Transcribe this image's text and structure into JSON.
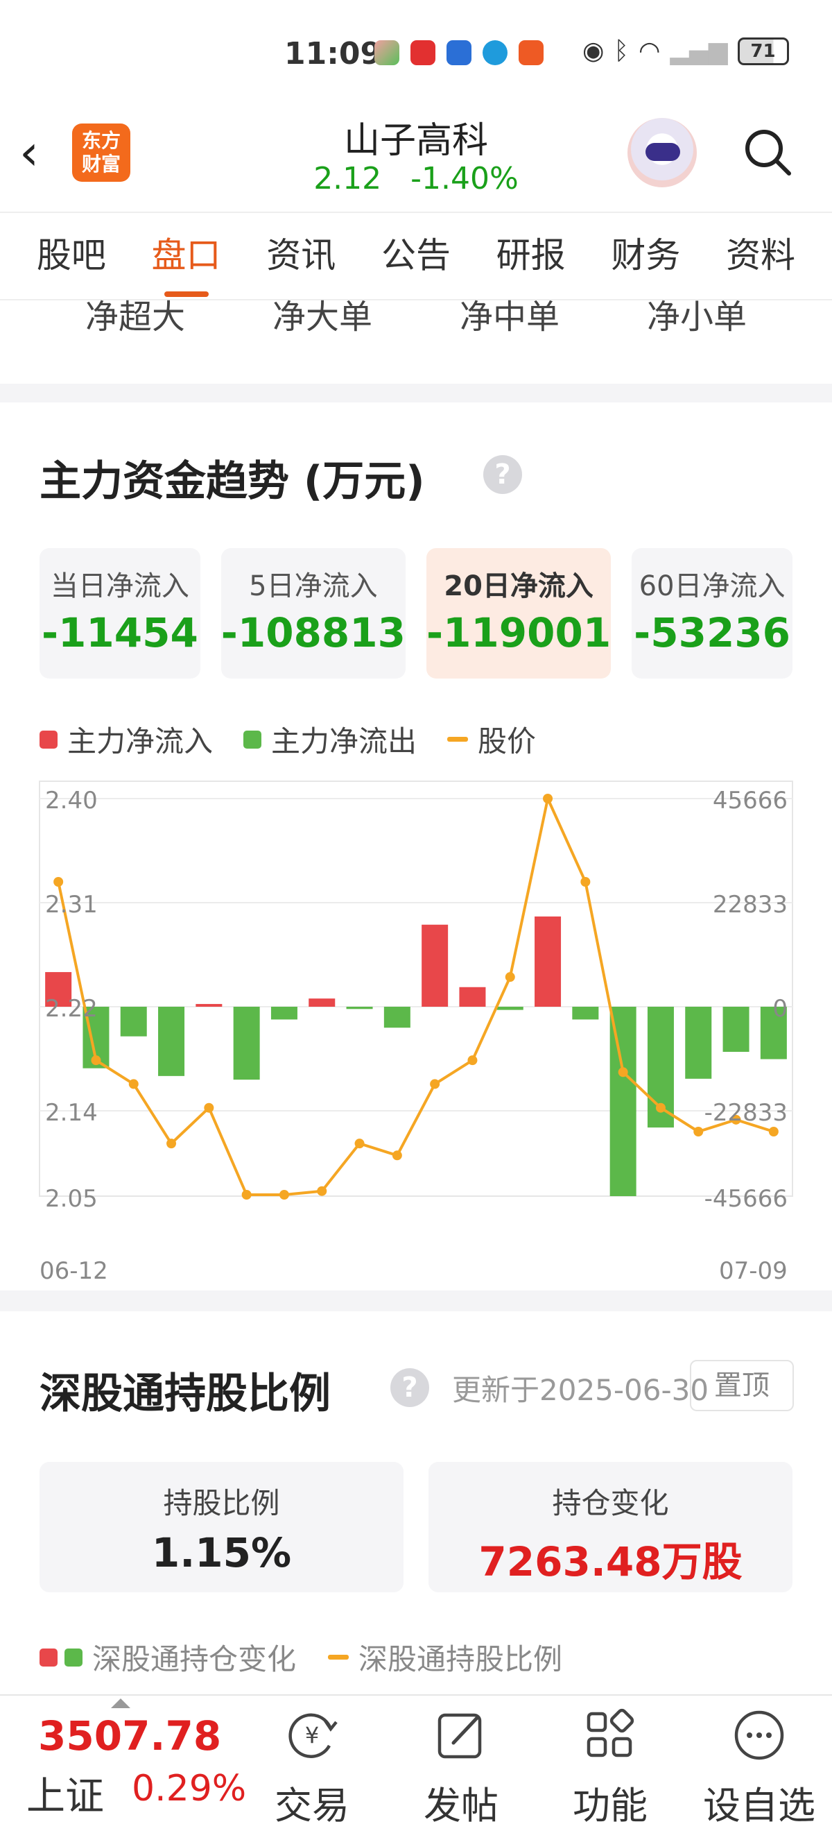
{
  "status_bar": {
    "time": "11:09",
    "battery": "71"
  },
  "header": {
    "logo_text": "东方\n财富",
    "title": "山子高科",
    "price": "2.12",
    "change": "-1.40%"
  },
  "tabs": [
    {
      "label": "股吧",
      "active": false
    },
    {
      "label": "盘口",
      "active": true
    },
    {
      "label": "资讯",
      "active": false
    },
    {
      "label": "公告",
      "active": false
    },
    {
      "label": "研报",
      "active": false
    },
    {
      "label": "财务",
      "active": false
    },
    {
      "label": "资料",
      "active": false
    }
  ],
  "sub_tabs": [
    "净超大",
    "净大单",
    "净中单",
    "净小单"
  ],
  "fund_trend": {
    "title": "主力资金趋势 (万元)",
    "help": "?",
    "flows": [
      {
        "label": "当日净流入",
        "value": "-11454",
        "active": false
      },
      {
        "label": "5日净流入",
        "value": "-108813",
        "active": false
      },
      {
        "label": "20日净流入",
        "value": "-119001",
        "active": true
      },
      {
        "label": "60日净流入",
        "value": "-53236",
        "active": false
      }
    ],
    "legend": {
      "inflow": "主力净流入",
      "outflow": "主力净流出",
      "price": "股价"
    },
    "colors": {
      "inflow": "#e8474a",
      "outflow": "#5cb84a",
      "price": "#f5a623"
    }
  },
  "chart_data": {
    "type": "bar",
    "x_start": "06-12",
    "x_end": "07-09",
    "left_ticks": [
      "2.40",
      "2.31",
      "2.22",
      "2.14",
      "2.05"
    ],
    "right_ticks": [
      "45666",
      "22833",
      "0",
      "-22833",
      "-45666"
    ],
    "ylim_price": [
      2.05,
      2.4
    ],
    "ylim_flow": [
      -45666,
      45666
    ],
    "series": [
      {
        "name": "主力净流入/流出",
        "values": [
          7600,
          -13500,
          -6500,
          -15200,
          600,
          -16000,
          -2800,
          1800,
          -500,
          -4600,
          18000,
          4300,
          -700,
          19800,
          -2800,
          -45666,
          -26500,
          -15800,
          -9900,
          -11500
        ]
      },
      {
        "name": "股价",
        "values": [
          2.33,
          2.18,
          2.16,
          2.11,
          2.14,
          2.05,
          2.06,
          2.07,
          2.11,
          2.1,
          2.16,
          2.18,
          2.25,
          2.4,
          2.33,
          2.17,
          2.14,
          2.12,
          2.13,
          2.12
        ]
      }
    ]
  },
  "sgt": {
    "title": "深股通持股比例",
    "help": "?",
    "update": "更新于2025-06-30",
    "pin": "置顶",
    "hold_ratio_label": "持股比例",
    "hold_ratio_value": "1.15%",
    "hold_change_label": "持仓变化",
    "hold_change_value": "7263.48万股",
    "legend_change": "深股通持仓变化",
    "legend_ratio": "深股通持股比例"
  },
  "bottom_bar": {
    "index_value": "3507.78",
    "index_name": "上证",
    "index_pct": "0.29%",
    "buttons": [
      "交易",
      "发帖",
      "功能",
      "设自选"
    ]
  }
}
